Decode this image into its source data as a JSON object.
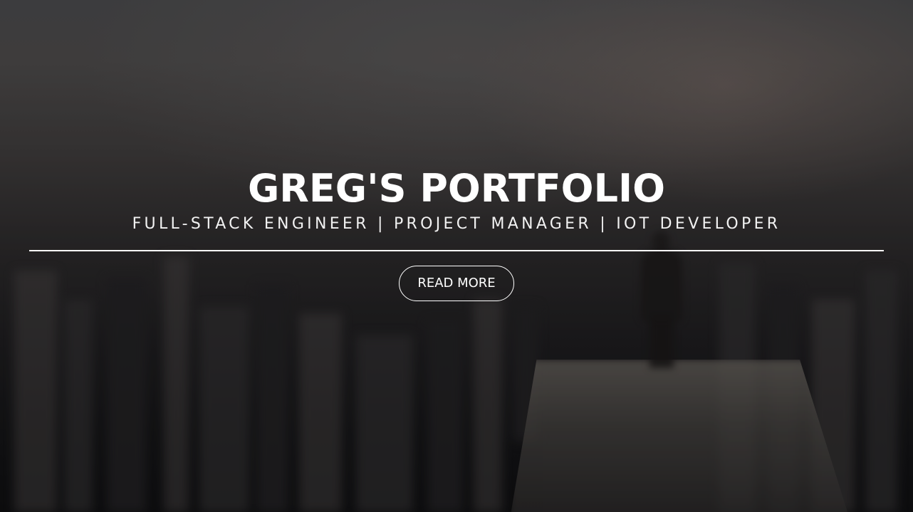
{
  "hero": {
    "title": "GREG'S PORTFOLIO",
    "subtitle": "FULL-STACK ENGINEER | PROJECT MANAGER | IOT DEVELOPER",
    "button_label": "READ MORE"
  },
  "colors": {
    "text": "#ffffff",
    "divider": "#ffffff",
    "button_border": "#ffffff",
    "background_dark": "#141416"
  }
}
